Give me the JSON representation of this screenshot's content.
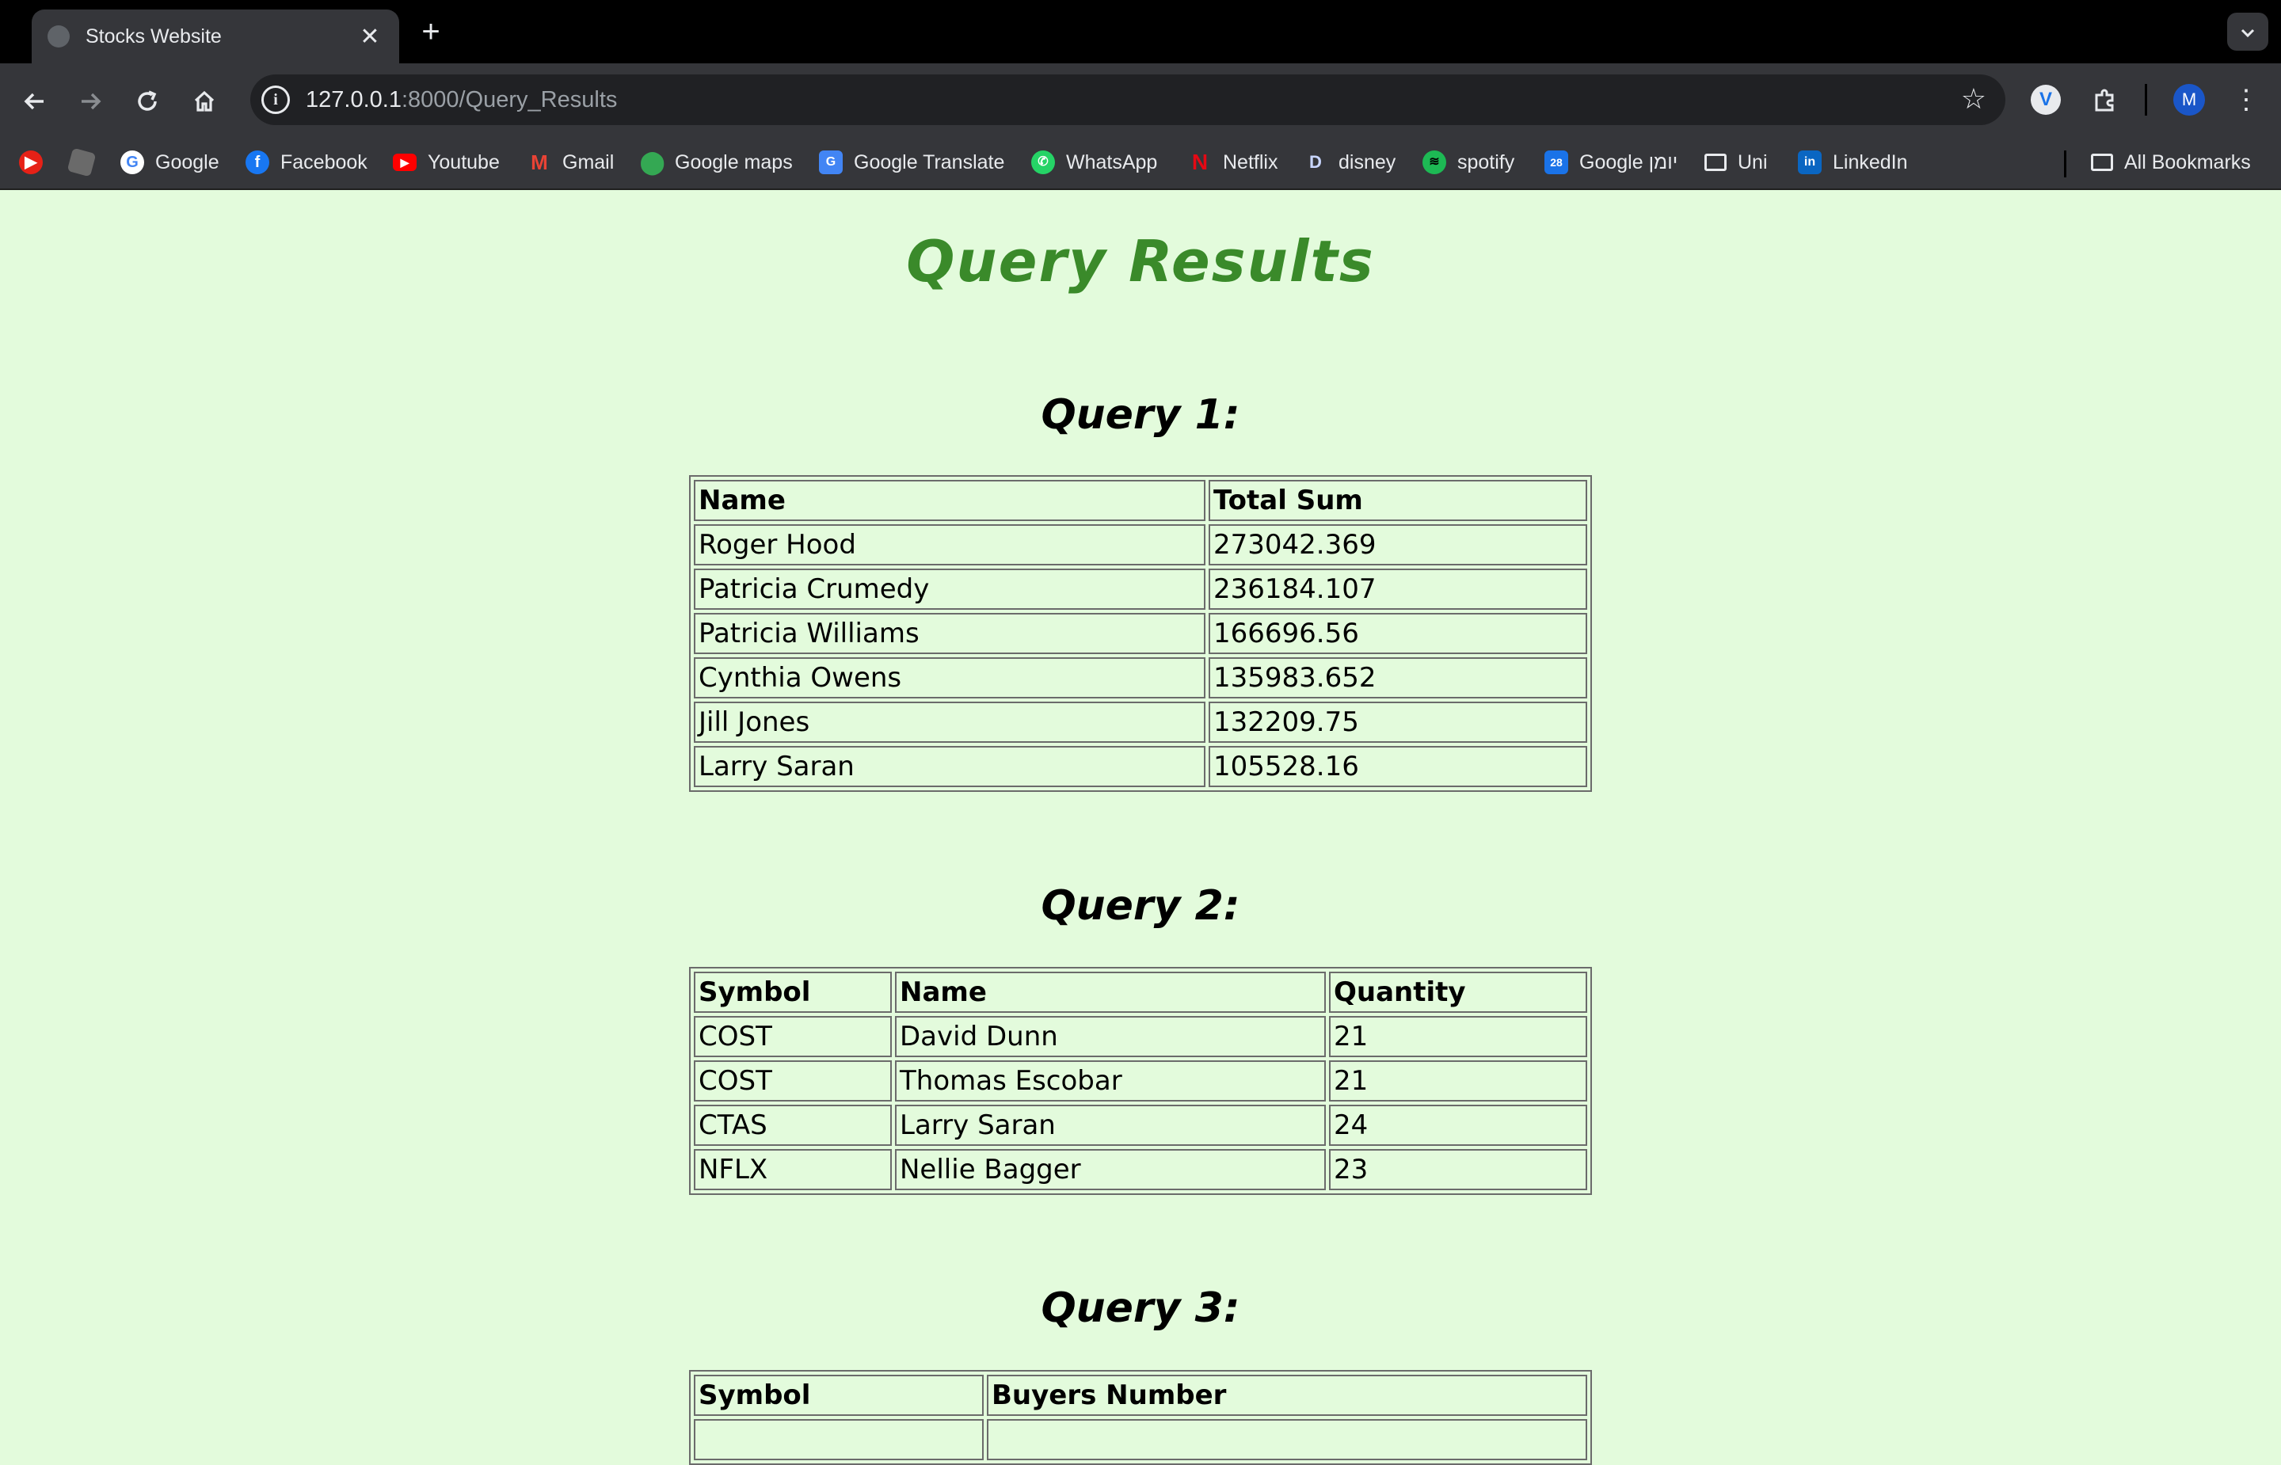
{
  "browser": {
    "tab_title": "Stocks Website",
    "tab_close": "✕",
    "new_tab": "+",
    "url_host": "127.0.0.1",
    "url_path": ":8000/Query_Results",
    "avatar_letter": "M",
    "bookmarks": [
      {
        "label": "",
        "icon": "youtube-music-icon"
      },
      {
        "label": "",
        "icon": "roblox-icon"
      },
      {
        "label": "Google",
        "icon": "google-icon"
      },
      {
        "label": "Facebook",
        "icon": "facebook-icon"
      },
      {
        "label": "Youtube",
        "icon": "youtube-icon"
      },
      {
        "label": "Gmail",
        "icon": "gmail-icon"
      },
      {
        "label": "Google maps",
        "icon": "maps-icon"
      },
      {
        "label": "Google Translate",
        "icon": "translate-icon"
      },
      {
        "label": "WhatsApp",
        "icon": "whatsapp-icon"
      },
      {
        "label": "Netflix",
        "icon": "netflix-icon"
      },
      {
        "label": "disney",
        "icon": "disney-icon"
      },
      {
        "label": "spotify",
        "icon": "spotify-icon"
      },
      {
        "label": "Google יומן",
        "icon": "calendar-icon"
      },
      {
        "label": "Uni",
        "icon": "folder-icon"
      },
      {
        "label": "LinkedIn",
        "icon": "linkedin-icon"
      }
    ],
    "all_bookmarks": "All Bookmarks"
  },
  "page": {
    "title": "Query Results",
    "query1": {
      "heading": "Query 1:",
      "headers": [
        "Name",
        "Total Sum"
      ],
      "rows": [
        [
          "Roger Hood",
          "273042.369"
        ],
        [
          "Patricia Crumedy",
          "236184.107"
        ],
        [
          "Patricia Williams",
          "166696.56"
        ],
        [
          "Cynthia Owens",
          "135983.652"
        ],
        [
          "Jill Jones",
          "132209.75"
        ],
        [
          "Larry Saran",
          "105528.16"
        ]
      ]
    },
    "query2": {
      "heading": "Query 2:",
      "headers": [
        "Symbol",
        "Name",
        "Quantity"
      ],
      "rows": [
        [
          "COST",
          "David Dunn",
          "21"
        ],
        [
          "COST",
          "Thomas Escobar",
          "21"
        ],
        [
          "CTAS",
          "Larry Saran",
          "24"
        ],
        [
          "NFLX",
          "Nellie Bagger",
          "23"
        ]
      ]
    },
    "query3": {
      "heading": "Query 3:",
      "headers": [
        "Symbol",
        "Buyers Number"
      ]
    }
  },
  "colors": {
    "page_background": "#e3fbdc",
    "title_green": "#3a8a2a",
    "chrome_dark": "#35363a"
  }
}
